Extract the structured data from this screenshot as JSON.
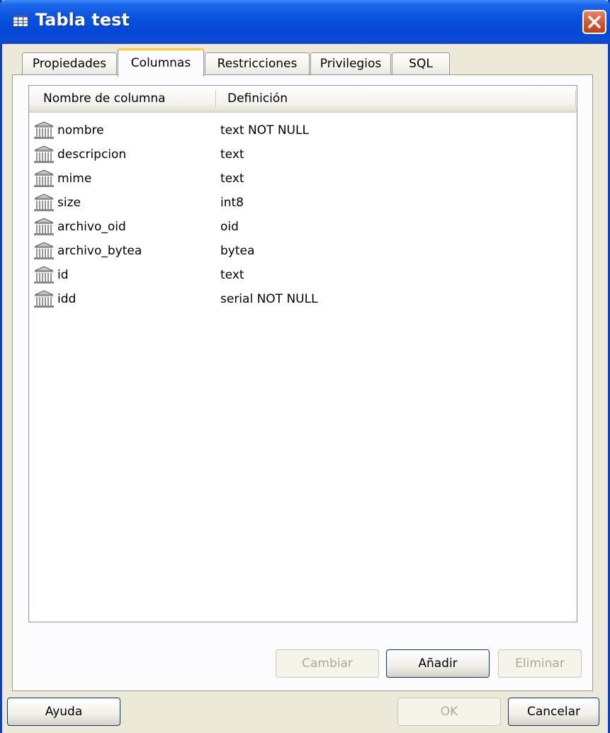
{
  "window": {
    "title": "Tabla test"
  },
  "tabs": [
    {
      "label": "Propiedades",
      "active": false
    },
    {
      "label": "Columnas",
      "active": true
    },
    {
      "label": "Restricciones",
      "active": false
    },
    {
      "label": "Privilegios",
      "active": false
    },
    {
      "label": "SQL",
      "active": false
    }
  ],
  "columns_list": {
    "headers": {
      "name": "Nombre de columna",
      "definition": "Definición"
    },
    "rows": [
      {
        "name": "nombre",
        "definition": "text NOT NULL"
      },
      {
        "name": "descripcion",
        "definition": "text"
      },
      {
        "name": "mime",
        "definition": "text"
      },
      {
        "name": "size",
        "definition": "int8"
      },
      {
        "name": "archivo_oid",
        "definition": "oid"
      },
      {
        "name": "archivo_bytea",
        "definition": "bytea"
      },
      {
        "name": "id",
        "definition": "text"
      },
      {
        "name": "idd",
        "definition": "serial NOT NULL"
      }
    ]
  },
  "panel_buttons": {
    "change": {
      "label": "Cambiar",
      "enabled": false
    },
    "add": {
      "label": "Añadir",
      "enabled": true
    },
    "remove": {
      "label": "Eliminar",
      "enabled": false
    }
  },
  "dialog_buttons": {
    "help": {
      "label": "Ayuda",
      "enabled": true
    },
    "ok": {
      "label": "OK",
      "enabled": false
    },
    "cancel": {
      "label": "Cancelar",
      "enabled": true
    }
  },
  "colors": {
    "titlebar": "#0a52e0",
    "active_tab_accent": "#ffc83c",
    "close_button": "#d45a38",
    "dialog_face": "#ece9d8"
  }
}
